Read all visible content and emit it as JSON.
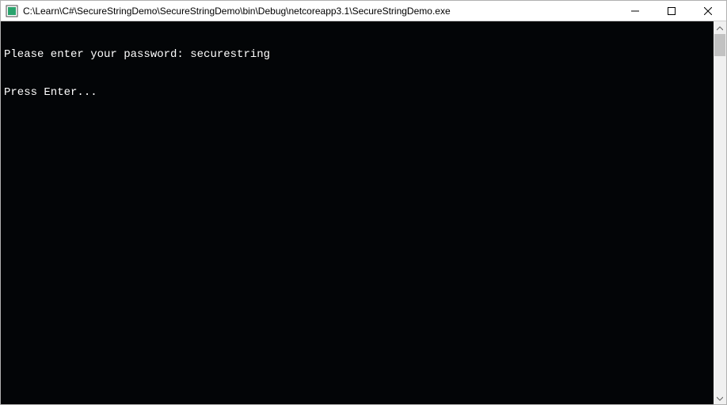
{
  "window": {
    "title": "C:\\Learn\\C#\\SecureStringDemo\\SecureStringDemo\\bin\\Debug\\netcoreapp3.1\\SecureStringDemo.exe",
    "icon": "console-app-icon"
  },
  "controls": {
    "minimize": "minimize-icon",
    "maximize": "maximize-icon",
    "close": "close-icon"
  },
  "console": {
    "lines": [
      "Please enter your password: securestring",
      "Press Enter..."
    ]
  },
  "scrollbar": {
    "up": "chevron-up-icon",
    "down": "chevron-down-icon"
  }
}
